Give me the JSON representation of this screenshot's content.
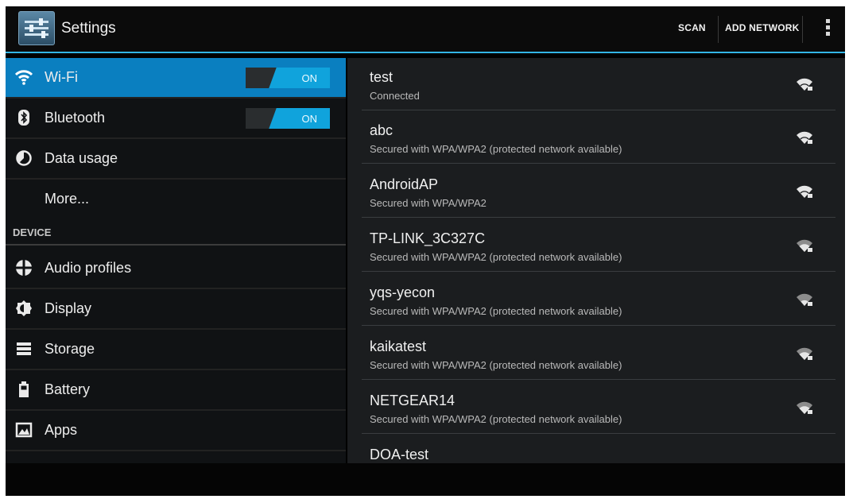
{
  "app": {
    "title": "Settings"
  },
  "actionbar": {
    "scan": "SCAN",
    "add_network": "ADD NETWORK"
  },
  "sidebar": {
    "items": [
      {
        "label": "Wi-Fi",
        "icon": "wifi-icon",
        "toggle": "ON"
      },
      {
        "label": "Bluetooth",
        "icon": "bluetooth-icon",
        "toggle": "ON"
      },
      {
        "label": "Data usage",
        "icon": "data-usage-icon"
      },
      {
        "label": "More..."
      }
    ],
    "device_header": "DEVICE",
    "device_items": [
      {
        "label": "Audio profiles",
        "icon": "audio-profiles-icon"
      },
      {
        "label": "Display",
        "icon": "display-icon"
      },
      {
        "label": "Storage",
        "icon": "storage-icon"
      },
      {
        "label": "Battery",
        "icon": "battery-icon"
      },
      {
        "label": "Apps",
        "icon": "apps-icon"
      }
    ]
  },
  "networks": [
    {
      "ssid": "test",
      "status": "Connected"
    },
    {
      "ssid": "abc",
      "status": "Secured with WPA/WPA2 (protected network available)"
    },
    {
      "ssid": "AndroidAP",
      "status": "Secured with WPA/WPA2"
    },
    {
      "ssid": "TP-LINK_3C327C",
      "status": "Secured with WPA/WPA2 (protected network available)"
    },
    {
      "ssid": "yqs-yecon",
      "status": "Secured with WPA/WPA2 (protected network available)"
    },
    {
      "ssid": "kaikatest",
      "status": "Secured with WPA/WPA2 (protected network available)"
    },
    {
      "ssid": "NETGEAR14",
      "status": "Secured with WPA/WPA2 (protected network available)"
    },
    {
      "ssid": "DOA-test",
      "status": ""
    }
  ],
  "colors": {
    "accent": "#33b5e5",
    "selected": "#0a7fc0",
    "toggle_on": "#10a3dc"
  }
}
